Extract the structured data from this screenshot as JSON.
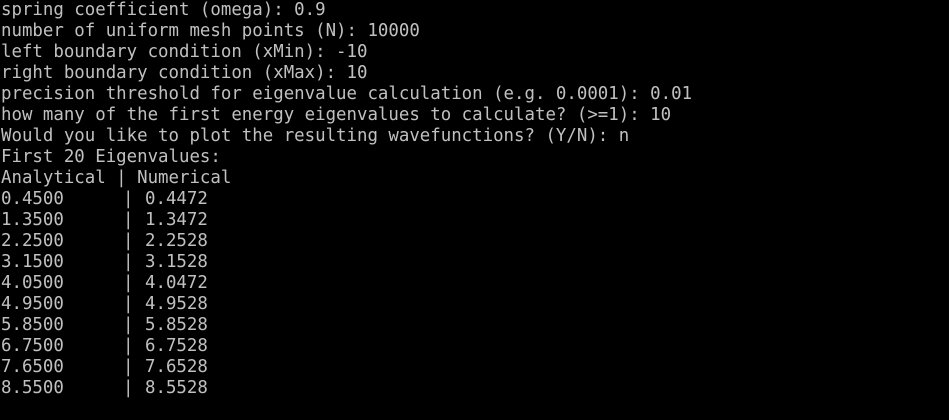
{
  "prompts": [
    {
      "label": "spring coefficient (omega): ",
      "value": "0.9"
    },
    {
      "label": "number of uniform mesh points (N): ",
      "value": "10000"
    },
    {
      "label": "left boundary condition (xMin): ",
      "value": "-10"
    },
    {
      "label": "right boundary condition (xMax): ",
      "value": "10"
    },
    {
      "label": "precision threshold for eigenvalue calculation (e.g. 0.0001): ",
      "value": "0.01"
    },
    {
      "label": "how many of the first energy eigenvalues to calculate? (>=1): ",
      "value": "10"
    },
    {
      "label": "Would you like to plot the resulting wavefunctions? (Y/N): ",
      "value": "n"
    }
  ],
  "results": {
    "title": "First 20 Eigenvalues:",
    "header": "Analytical | Numerical",
    "separator": "|",
    "rows": [
      {
        "analytical": "0.4500",
        "numerical": "0.4472"
      },
      {
        "analytical": "1.3500",
        "numerical": "1.3472"
      },
      {
        "analytical": "2.2500",
        "numerical": "2.2528"
      },
      {
        "analytical": "3.1500",
        "numerical": "3.1528"
      },
      {
        "analytical": "4.0500",
        "numerical": "4.0472"
      },
      {
        "analytical": "4.9500",
        "numerical": "4.9528"
      },
      {
        "analytical": "5.8500",
        "numerical": "5.8528"
      },
      {
        "analytical": "6.7500",
        "numerical": "6.7528"
      },
      {
        "analytical": "7.6500",
        "numerical": "7.6528"
      },
      {
        "analytical": "8.5500",
        "numerical": "8.5528"
      }
    ]
  },
  "colors": {
    "background": "#000000",
    "text": "#c0c0c0"
  }
}
